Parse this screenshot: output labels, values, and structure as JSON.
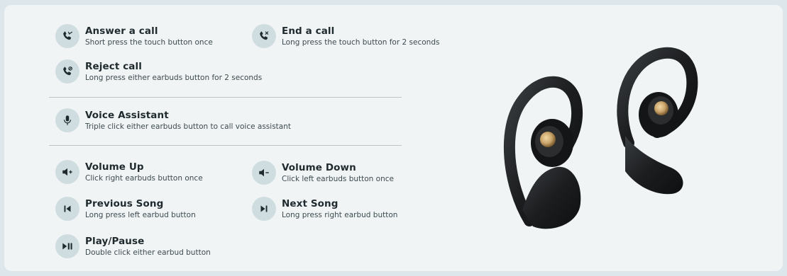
{
  "controls": {
    "answer_call": {
      "title": "Answer a call",
      "desc": "Short press the touch button once"
    },
    "end_call": {
      "title": "End a call",
      "desc": "Long press the touch button for 2 seconds"
    },
    "reject_call": {
      "title": "Reject call",
      "desc": "Long press either earbuds button for 2 seconds"
    },
    "voice_assistant": {
      "title": "Voice Assistant",
      "desc": "Triple click either earbuds button to call voice assistant"
    },
    "volume_up": {
      "title": "Volume Up",
      "desc": "Click right earbuds button once"
    },
    "volume_down": {
      "title": "Volume Down",
      "desc": "Click left earbuds button once"
    },
    "previous_song": {
      "title": "Previous Song",
      "desc": "Long press left earbud button"
    },
    "next_song": {
      "title": "Next Song",
      "desc": "Long press right earbud button"
    },
    "play_pause": {
      "title": "Play/Pause",
      "desc": "Double click either earbud button"
    }
  },
  "icons": {
    "answer_call": "phone-answer-icon",
    "end_call": "phone-end-icon",
    "reject_call": "phone-reject-icon",
    "voice_assistant": "microphone-icon",
    "volume_up": "volume-up-icon",
    "volume_down": "volume-down-icon",
    "previous_song": "previous-track-icon",
    "next_song": "next-track-icon",
    "play_pause": "play-pause-icon"
  },
  "colors": {
    "background": "#dde6ea",
    "card": "#f1f4f5",
    "icon_bg": "#cfdde1",
    "icon_fg": "#1f2a2e",
    "earbud_body": "#1a1c1e",
    "earbud_accent": "#c9a46a"
  }
}
